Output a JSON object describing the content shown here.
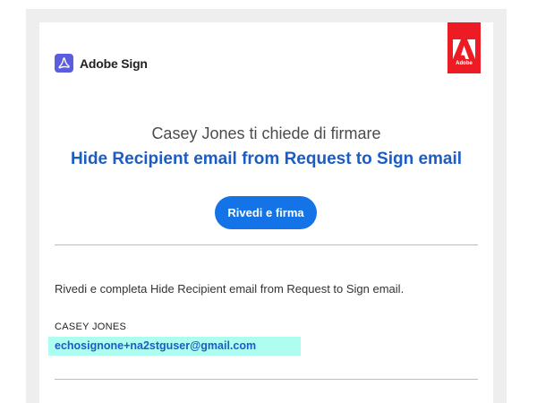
{
  "header": {
    "brand_name": "Adobe Sign",
    "brand_icon": "adobe-sign-icon",
    "badge_text": "Adobe",
    "badge_icon": "adobe-logo-icon",
    "badge_color": "#ed1c24"
  },
  "hero": {
    "subtitle": "Casey Jones ti chiede di firmare",
    "document_title": "Hide Recipient email from Request to Sign email",
    "cta_label": "Rivedi e firma",
    "cta_color": "#1473e6",
    "title_color": "#1b5cc5"
  },
  "message": {
    "body": "Rivedi e completa Hide Recipient email from Request to Sign email.",
    "sender_name": "CASEY JONES",
    "sender_email": "echosignone+na2stguser@gmail.com",
    "email_highlight_color": "#adfef0"
  }
}
